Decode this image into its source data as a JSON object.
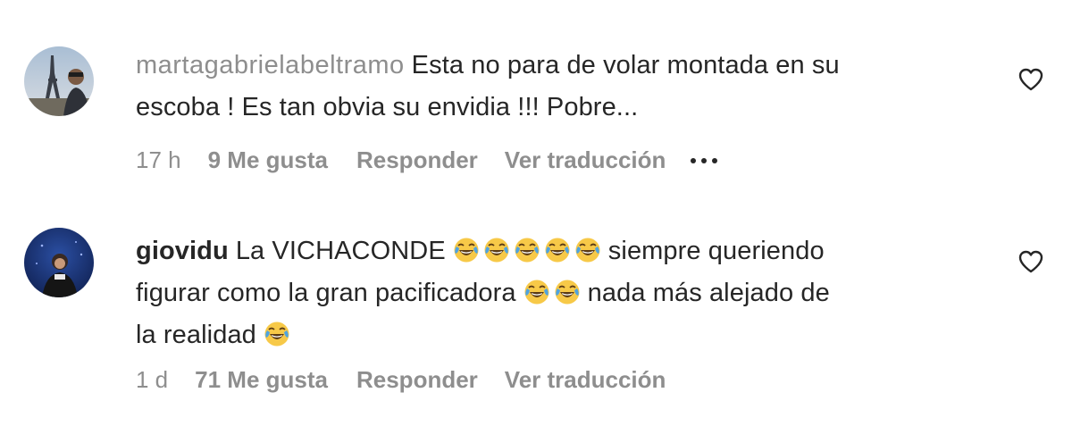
{
  "comments": [
    {
      "username": "martagabrielabeltramo",
      "text_lines": [
        "Esta no para de volar montada en su",
        "escoba ! Es tan obvia su envidia !!! Pobre..."
      ],
      "time": "17 h",
      "likes": "9 Me gusta",
      "reply_label": "Responder",
      "translate_label": "Ver traducción",
      "more_icon": "more-options-icon",
      "like_icon": "heart-outline-icon"
    },
    {
      "username": "giovidu",
      "text_segments": [
        "La VICHACONDE",
        "siempre queriendo",
        "figurar como la gran pacificadora",
        "nada más alejado de",
        "la realidad"
      ],
      "emoji_name": "tears-of-joy-emoji",
      "time": "1 d",
      "likes": "71 Me gusta",
      "reply_label": "Responder",
      "translate_label": "Ver traducción",
      "like_icon": "heart-outline-icon"
    }
  ],
  "colors": {
    "primary_text": "#262626",
    "secondary_text": "#8e8e8e",
    "emoji_face": "#f7c948",
    "emoji_tears": "#4fa3e0"
  }
}
